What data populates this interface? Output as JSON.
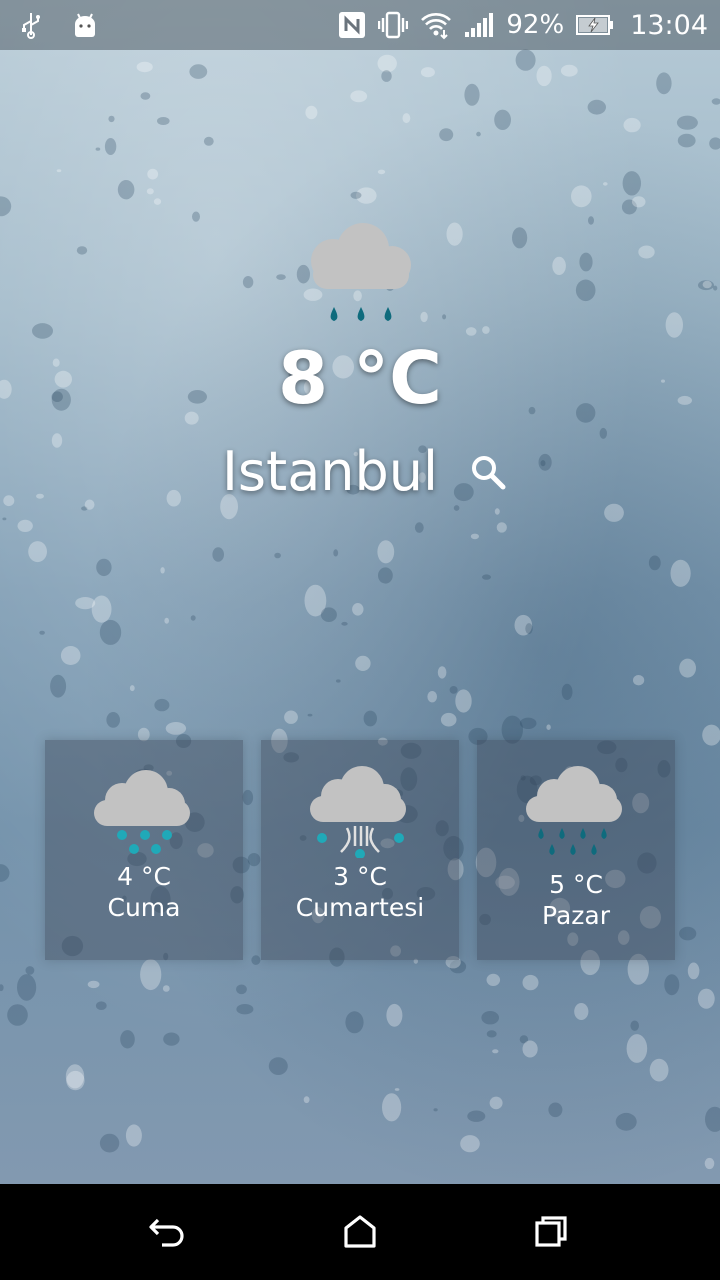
{
  "status_bar": {
    "left_icons": [
      "usb-icon",
      "android-icon"
    ],
    "right_icons": [
      "nfc-icon",
      "vibrate-icon",
      "wifi-icon",
      "signal-icon"
    ],
    "battery_percent": "92%",
    "battery_icon": "battery-charging-icon",
    "time": "13:04"
  },
  "current": {
    "icon": "rain-cloud-icon",
    "temperature": "8 °C",
    "city": "Istanbul",
    "search_icon": "search-icon"
  },
  "forecast": [
    {
      "icon": "light-rain-cloud-icon",
      "temperature": "4  °C",
      "day": "Cuma"
    },
    {
      "icon": "hail-cloud-icon",
      "temperature": "3  °C",
      "day": "Cumartesi"
    },
    {
      "icon": "heavy-rain-cloud-icon",
      "temperature": "5  °C",
      "day": "Pazar"
    }
  ],
  "nav_bar": {
    "back_icon": "back-icon",
    "home_icon": "home-icon",
    "recents_icon": "recents-icon"
  },
  "colors": {
    "cloud": "#c2c2c2",
    "drop_dark": "#0f6b7d",
    "drop_cyan": "#20a9b8",
    "card_bg": "rgba(60,70,85,0.42)"
  }
}
